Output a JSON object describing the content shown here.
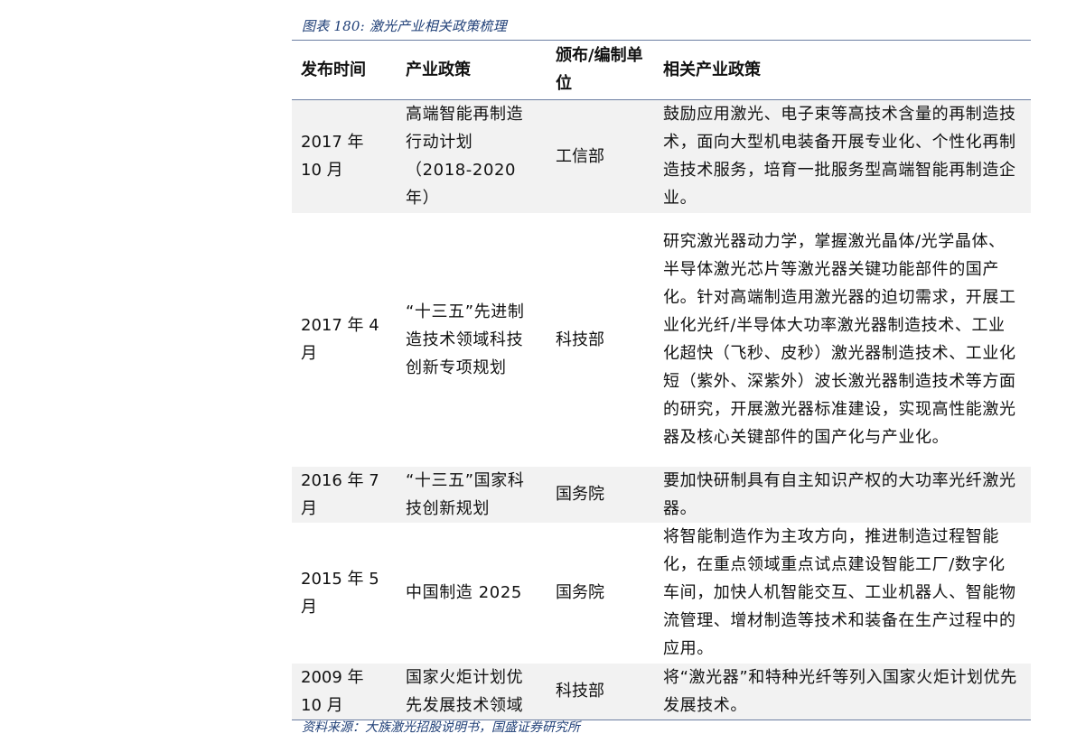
{
  "caption": "图表 180:  激光产业相关政策梳理",
  "table": {
    "headers": {
      "date": "发布时间",
      "policy": "产业政策",
      "unit": "颁布/编制单位",
      "content": "相关产业政策"
    },
    "rows": [
      {
        "date": "2017 年 10 月",
        "policy": "高端智能再制造行动计划（2018-2020 年）",
        "unit": "工信部",
        "content": "鼓励应用激光、电子束等高技术含量的再制造技术，面向大型机电装备开展专业化、个性化再制造技术服务，培育一批服务型高端智能再制造企业。"
      },
      {
        "date": "2017 年 4 月",
        "policy": "“十三五”先进制造技术领域科技创新专项规划",
        "unit": "科技部",
        "content": "研究激光器动力学，掌握激光晶体/光学晶体、半导体激光芯片等激光器关键功能部件的国产化。针对高端制造用激光器的迫切需求，开展工业化光纤/半导体大功率激光器制造技术、工业化超快（飞秒、皮秒）激光器制造技术、工业化短（紫外、深紫外）波长激光器制造技术等方面的研究，开展激光器标准建设，实现高性能激光器及核心关键部件的国产化与产业化。"
      },
      {
        "date": "2016 年 7 月",
        "policy": "“十三五”国家科技创新规划",
        "unit": "国务院",
        "content": "要加快研制具有自主知识产权的大功率光纤激光器。"
      },
      {
        "date": "2015 年 5 月",
        "policy": "中国制造 2025",
        "unit": "国务院",
        "content": "将智能制造作为主攻方向，推进制造过程智能化，在重点领域重点试点建设智能工厂/数字化车间，加快人机智能交互、工业机器人、智能物流管理、增材制造等技术和装备在生产过程中的应用。"
      },
      {
        "date": "2009 年 10 月",
        "policy": "国家火炬计划优先发展技术领域",
        "unit": "科技部",
        "content": "将“激光器”和特种光纤等列入国家火炬计划优先发展技术。"
      }
    ]
  },
  "source": "资料来源：大族激光招股说明书，国盛证券研究所"
}
